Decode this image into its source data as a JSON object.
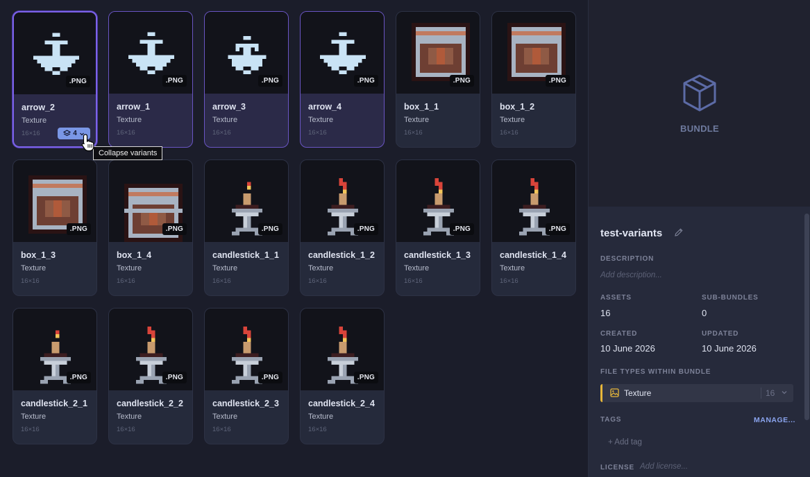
{
  "assets": [
    {
      "name": "arrow_2",
      "type": "Texture",
      "size": "16×16",
      "ext": ".PNG",
      "sprite": "arrow2",
      "variant": true,
      "selected": true,
      "variant_count": "4"
    },
    {
      "name": "arrow_1",
      "type": "Texture",
      "size": "16×16",
      "ext": ".PNG",
      "sprite": "arrow1",
      "variant": true
    },
    {
      "name": "arrow_3",
      "type": "Texture",
      "size": "16×16",
      "ext": ".PNG",
      "sprite": "arrow3",
      "variant": true
    },
    {
      "name": "arrow_4",
      "type": "Texture",
      "size": "16×16",
      "ext": ".PNG",
      "sprite": "arrow4",
      "variant": true
    },
    {
      "name": "box_1_1",
      "type": "Texture",
      "size": "16×16",
      "ext": ".PNG",
      "sprite": "box"
    },
    {
      "name": "box_1_2",
      "type": "Texture",
      "size": "16×16",
      "ext": ".PNG",
      "sprite": "box2"
    },
    {
      "name": "box_1_3",
      "type": "Texture",
      "size": "16×16",
      "ext": ".PNG",
      "sprite": "box3"
    },
    {
      "name": "box_1_4",
      "type": "Texture",
      "size": "16×16",
      "ext": ".PNG",
      "sprite": "box4"
    },
    {
      "name": "candlestick_1_1",
      "type": "Texture",
      "size": "16×16",
      "ext": ".PNG",
      "sprite": "candle1"
    },
    {
      "name": "candlestick_1_2",
      "type": "Texture",
      "size": "16×16",
      "ext": ".PNG",
      "sprite": "candle1b"
    },
    {
      "name": "candlestick_1_3",
      "type": "Texture",
      "size": "16×16",
      "ext": ".PNG",
      "sprite": "candle1c"
    },
    {
      "name": "candlestick_1_4",
      "type": "Texture",
      "size": "16×16",
      "ext": ".PNG",
      "sprite": "candle1d"
    },
    {
      "name": "candlestick_2_1",
      "type": "Texture",
      "size": "16×16",
      "ext": ".PNG",
      "sprite": "candle2"
    },
    {
      "name": "candlestick_2_2",
      "type": "Texture",
      "size": "16×16",
      "ext": ".PNG",
      "sprite": "candle2b"
    },
    {
      "name": "candlestick_2_3",
      "type": "Texture",
      "size": "16×16",
      "ext": ".PNG",
      "sprite": "candle2c"
    },
    {
      "name": "candlestick_2_4",
      "type": "Texture",
      "size": "16×16",
      "ext": ".PNG",
      "sprite": "candle2d"
    }
  ],
  "tooltip": "Collapse variants",
  "preview": {
    "label": "BUNDLE",
    "icon": "cube-icon"
  },
  "details": {
    "title": "test-variants",
    "description_label": "DESCRIPTION",
    "description_placeholder": "Add description...",
    "assets_label": "ASSETS",
    "assets_value": "16",
    "subbundles_label": "SUB-BUNDLES",
    "subbundles_value": "0",
    "created_label": "CREATED",
    "created_value": "10 June 2026",
    "updated_label": "UPDATED",
    "updated_value": "10 June 2026",
    "filetypes_label": "FILE TYPES WITHIN BUNDLE",
    "filetype_name": "Texture",
    "filetype_count": "16",
    "tags_label": "TAGS",
    "manage_label": "MANAGE...",
    "add_tag_label": "+ Add tag",
    "license_label": "LICENSE",
    "license_placeholder": "Add license..."
  },
  "colors": {
    "accent": "#7c62e8",
    "badge": "#7a97e6",
    "texture_bar": "#e7b73a",
    "manage_link": "#8aa4ee"
  }
}
